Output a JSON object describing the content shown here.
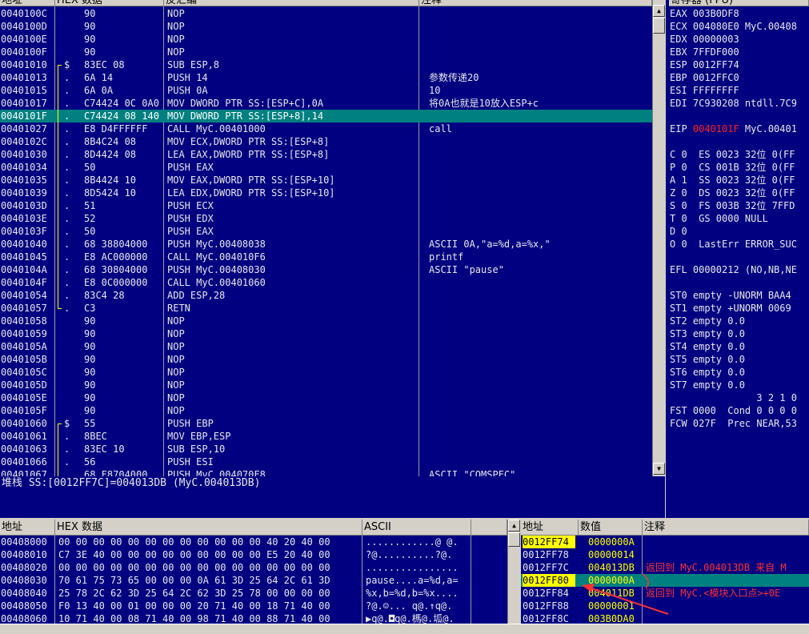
{
  "disasm": {
    "headers": [
      "地址",
      "HEX 数据",
      "反汇编",
      "注释"
    ],
    "rows": [
      {
        "addr": "0040100C",
        "mark": "",
        "hex": "90",
        "asm": "NOP",
        "comment": ""
      },
      {
        "addr": "0040100D",
        "mark": "",
        "hex": "90",
        "asm": "NOP",
        "comment": ""
      },
      {
        "addr": "0040100E",
        "mark": "",
        "hex": "90",
        "asm": "NOP",
        "comment": ""
      },
      {
        "addr": "0040100F",
        "mark": "",
        "hex": "90",
        "asm": "NOP",
        "comment": ""
      },
      {
        "addr": "00401010",
        "mark": "$",
        "hex": "83EC 08",
        "asm": "SUB ESP,8",
        "comment": ""
      },
      {
        "addr": "00401013",
        "mark": ".",
        "hex": "6A 14",
        "asm": "PUSH 14",
        "comment": "参数传递20"
      },
      {
        "addr": "00401015",
        "mark": ".",
        "hex": "6A 0A",
        "asm": "PUSH 0A",
        "comment": "10"
      },
      {
        "addr": "00401017",
        "mark": ".",
        "hex": "C74424 0C 0A0",
        "asm": "MOV DWORD PTR SS:[ESP+C],0A",
        "comment": "将0A也就是10放入ESP+c"
      },
      {
        "addr": "0040101F",
        "mark": ".",
        "hex": "C74424 08 140",
        "asm": "MOV DWORD PTR SS:[ESP+8],14",
        "comment": ""
      },
      {
        "addr": "00401027",
        "mark": ".",
        "hex": "E8 D4FFFFFF",
        "asm": "CALL MyC.00401000",
        "comment": "call"
      },
      {
        "addr": "0040102C",
        "mark": ".",
        "hex": "8B4C24 08",
        "asm": "MOV ECX,DWORD PTR SS:[ESP+8]",
        "comment": ""
      },
      {
        "addr": "00401030",
        "mark": ".",
        "hex": "8D4424 08",
        "asm": "LEA EAX,DWORD PTR SS:[ESP+8]",
        "comment": ""
      },
      {
        "addr": "00401034",
        "mark": ".",
        "hex": "50",
        "asm": "PUSH EAX",
        "comment": ""
      },
      {
        "addr": "00401035",
        "mark": ".",
        "hex": "8B4424 10",
        "asm": "MOV EAX,DWORD PTR SS:[ESP+10]",
        "comment": ""
      },
      {
        "addr": "00401039",
        "mark": ".",
        "hex": "8D5424 10",
        "asm": "LEA EDX,DWORD PTR SS:[ESP+10]",
        "comment": ""
      },
      {
        "addr": "0040103D",
        "mark": ".",
        "hex": "51",
        "asm": "PUSH ECX",
        "comment": ""
      },
      {
        "addr": "0040103E",
        "mark": ".",
        "hex": "52",
        "asm": "PUSH EDX",
        "comment": ""
      },
      {
        "addr": "0040103F",
        "mark": ".",
        "hex": "50",
        "asm": "PUSH EAX",
        "comment": ""
      },
      {
        "addr": "00401040",
        "mark": ".",
        "hex": "68 38804000",
        "asm": "PUSH MyC.00408038",
        "comment": "ASCII 0A,\"a=%d,a=%x,\""
      },
      {
        "addr": "00401045",
        "mark": ".",
        "hex": "E8 AC000000",
        "asm": "CALL MyC.004010F6",
        "comment": "printf"
      },
      {
        "addr": "0040104A",
        "mark": ".",
        "hex": "68 30804000",
        "asm": "PUSH MyC.00408030",
        "comment": "ASCII \"pause\""
      },
      {
        "addr": "0040104F",
        "mark": ".",
        "hex": "E8 0C000000",
        "asm": "CALL MyC.00401060",
        "comment": ""
      },
      {
        "addr": "00401054",
        "mark": ".",
        "hex": "83C4 28",
        "asm": "ADD ESP,28",
        "comment": ""
      },
      {
        "addr": "00401057",
        "mark": ".",
        "hex": "C3",
        "asm": "RETN",
        "comment": ""
      },
      {
        "addr": "00401058",
        "mark": "",
        "hex": "90",
        "asm": "NOP",
        "comment": ""
      },
      {
        "addr": "00401059",
        "mark": "",
        "hex": "90",
        "asm": "NOP",
        "comment": ""
      },
      {
        "addr": "0040105A",
        "mark": "",
        "hex": "90",
        "asm": "NOP",
        "comment": ""
      },
      {
        "addr": "0040105B",
        "mark": "",
        "hex": "90",
        "asm": "NOP",
        "comment": ""
      },
      {
        "addr": "0040105C",
        "mark": "",
        "hex": "90",
        "asm": "NOP",
        "comment": ""
      },
      {
        "addr": "0040105D",
        "mark": "",
        "hex": "90",
        "asm": "NOP",
        "comment": ""
      },
      {
        "addr": "0040105E",
        "mark": "",
        "hex": "90",
        "asm": "NOP",
        "comment": ""
      },
      {
        "addr": "0040105F",
        "mark": "",
        "hex": "90",
        "asm": "NOP",
        "comment": ""
      },
      {
        "addr": "00401060",
        "mark": "$",
        "hex": "55",
        "asm": "PUSH EBP",
        "comment": ""
      },
      {
        "addr": "00401061",
        "mark": ".",
        "hex": "8BEC",
        "asm": "MOV EBP,ESP",
        "comment": ""
      },
      {
        "addr": "00401063",
        "mark": ".",
        "hex": "83EC 10",
        "asm": "SUB ESP,10",
        "comment": ""
      },
      {
        "addr": "00401066",
        "mark": ".",
        "hex": "56",
        "asm": "PUSH ESI",
        "comment": ""
      },
      {
        "addr": "00401067",
        "mark": ".",
        "hex": "68 F8704000",
        "asm": "PUSH MyC.004070F8",
        "comment": "ASCII \"COMSPEC\""
      }
    ]
  },
  "info_line": "堆栈 SS:[0012FF7C]=004013DB (MyC.004013DB)",
  "registers": {
    "header": "寄存器 (FPU)",
    "lines": [
      {
        "text": "EAX 003B0DF8"
      },
      {
        "text": "ECX 004080E0 MyC.00408"
      },
      {
        "text": "EDX 00000003"
      },
      {
        "text": "EBX 7FFDF000"
      },
      {
        "text": "ESP 0012FF74"
      },
      {
        "text": "EBP 0012FFC0"
      },
      {
        "text": "ESI FFFFFFFF"
      },
      {
        "text": "EDI 7C930208 ntdll.7C9"
      },
      {
        "text": ""
      },
      {
        "text": "EIP ",
        "red": "0040101F",
        "rest": " MyC.00401"
      },
      {
        "text": ""
      },
      {
        "text": "C 0  ES 0023 32位 0(FF"
      },
      {
        "text": "P 0  CS 001B 32位 0(FF"
      },
      {
        "text": "A 1  SS 0023 32位 0(FF"
      },
      {
        "text": "Z 0  DS 0023 32位 0(FF"
      },
      {
        "text": "S 0  FS 003B 32位 7FFD"
      },
      {
        "text": "T 0  GS 0000 NULL"
      },
      {
        "text": "D 0"
      },
      {
        "text": "O 0  LastErr ERROR_SUC"
      },
      {
        "text": ""
      },
      {
        "text": "EFL 00000212 (NO,NB,NE"
      },
      {
        "text": ""
      },
      {
        "text": "ST0 empty -UNORM BAA4"
      },
      {
        "text": "ST1 empty +UNORM 0069"
      },
      {
        "text": "ST2 empty 0.0"
      },
      {
        "text": "ST3 empty 0.0"
      },
      {
        "text": "ST4 empty 0.0"
      },
      {
        "text": "ST5 empty 0.0"
      },
      {
        "text": "ST6 empty 0.0"
      },
      {
        "text": "ST7 empty 0.0"
      },
      {
        "text": "               3 2 1 0"
      },
      {
        "text": "FST 0000  Cond 0 0 0 0"
      },
      {
        "text": "FCW 027F  Prec NEAR,53"
      }
    ]
  },
  "dump": {
    "headers": [
      "地址",
      "HEX 数据",
      "ASCII"
    ],
    "rows": [
      {
        "addr": "00408000",
        "hex": "00 00 00 00 00 00 00 00 00 00 00 00 40 20 40 00",
        "ascii": "............@ @."
      },
      {
        "addr": "00408010",
        "hex": "C7 3E 40 00 00 00 00 00 00 00 00 00 E5 20 40 00",
        "ascii": "?@..........?@."
      },
      {
        "addr": "00408020",
        "hex": "00 00 00 00 00 00 00 00 00 00 00 00 00 00 00 00",
        "ascii": "................"
      },
      {
        "addr": "00408030",
        "hex": "70 61 75 73 65 00 00 00 0A 61 3D 25 64 2C 61 3D",
        "ascii": "pause....a=%d,a="
      },
      {
        "addr": "00408040",
        "hex": "25 78 2C 62 3D 25 64 2C 62 3D 25 78 00 00 00 00",
        "ascii": "%x,b=%d,b=%x...."
      },
      {
        "addr": "00408050",
        "hex": "F0 13 40 00 01 00 00 00 20 71 40 00 18 71 40 00",
        "ascii": "?@.☺... q@.↑q@."
      },
      {
        "addr": "00408060",
        "hex": "10 71 40 00 08 71 40 00 98 71 40 00 88 71 40 00",
        "ascii": "▶q@.◘q@.榪@.坬@."
      }
    ]
  },
  "stack": {
    "headers": [
      "地址",
      "数值",
      "注释"
    ],
    "rows": [
      {
        "addr": "0012FF74",
        "val": "0000000A",
        "comment": ""
      },
      {
        "addr": "0012FF78",
        "val": "00000014",
        "comment": ""
      },
      {
        "addr": "0012FF7C",
        "val": "004013DB",
        "comment": "返回到 MyC.004013DB 来自 M"
      },
      {
        "addr": "0012FF80",
        "val": "0000000A",
        "comment": ""
      },
      {
        "addr": "0012FF84",
        "val": "004011DB",
        "comment": "返回到 MyC.<模块入口点>+0E"
      },
      {
        "addr": "0012FF88",
        "val": "00000001",
        "comment": ""
      },
      {
        "addr": "0012FF8C",
        "val": "003B0DA0",
        "comment": ""
      }
    ]
  },
  "colors": {
    "panel": "#000080",
    "selected": "#008080",
    "accent_red": "#ff2020",
    "yellow_hl": "#ffff00",
    "annotation": "#ff3030"
  }
}
